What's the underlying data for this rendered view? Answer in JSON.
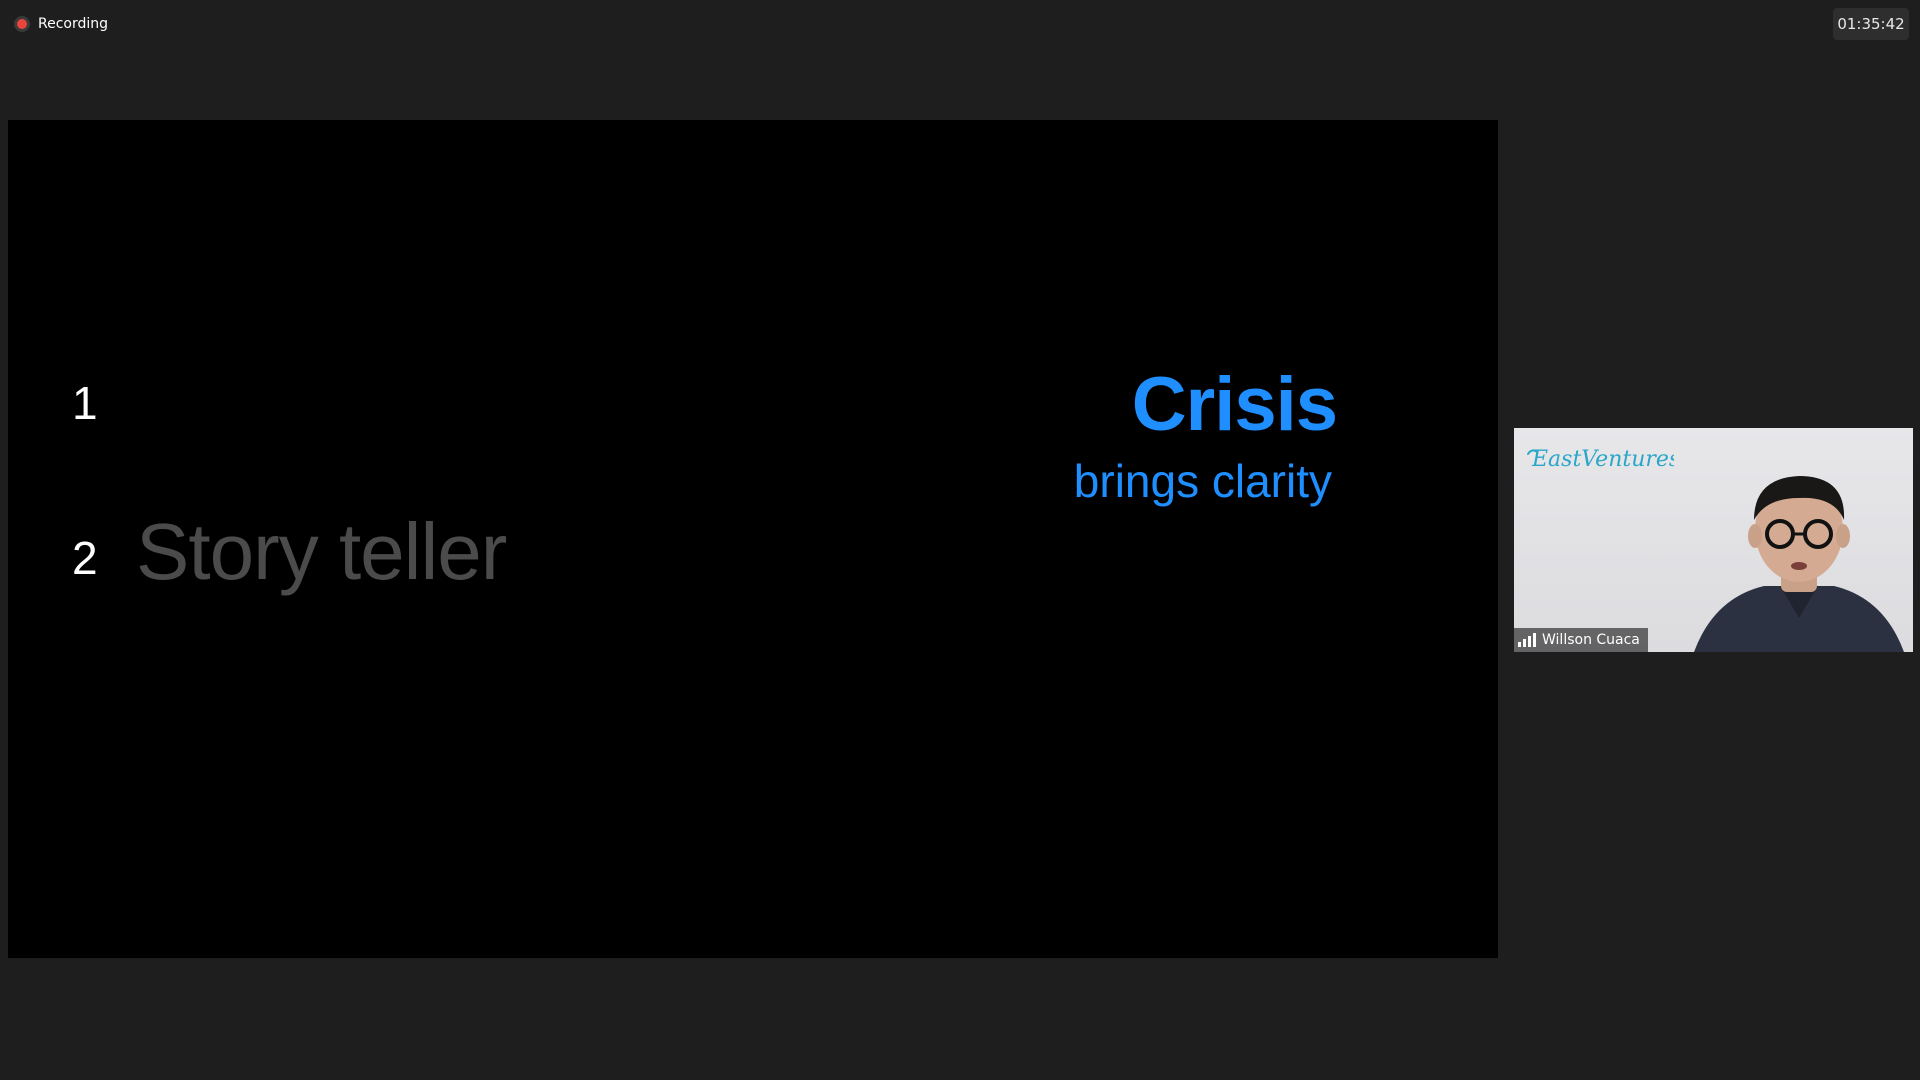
{
  "recording": {
    "label": "Recording",
    "icon": "record-icon",
    "color": "#e8453c"
  },
  "timer": {
    "elapsed": "01:35:42"
  },
  "slide": {
    "item1_number": "1",
    "item2_number": "2",
    "item2_text": "Story teller",
    "headline": "Crisis",
    "subheadline": "brings clarity",
    "accent_color": "#1f8fff"
  },
  "participant": {
    "name": "Willson Cuaca",
    "logo_text": "EastVentures",
    "signal_icon": "signal-strength-icon"
  }
}
